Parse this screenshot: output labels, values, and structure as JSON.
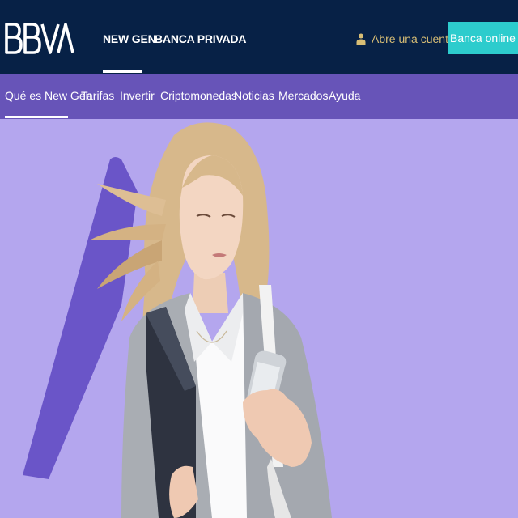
{
  "brand": {
    "logo_text": "BBVA"
  },
  "header": {
    "tabs": [
      {
        "label": "NEW GEN",
        "active": true
      },
      {
        "label": "BANCA PRIVADA",
        "active": false
      }
    ],
    "open_account": {
      "label": "Abre una cuenta",
      "icon": "person-icon"
    },
    "online_button": {
      "label": "Banca online"
    }
  },
  "subnav": {
    "items": [
      {
        "label": "Qué es New Gen",
        "active": true
      },
      {
        "label": "Tarifas"
      },
      {
        "label": "Invertir"
      },
      {
        "label": "Criptomonedas"
      },
      {
        "label": "Noticias"
      },
      {
        "label": "Mercados"
      },
      {
        "label": "Ayuda"
      }
    ]
  },
  "hero": {
    "image": "woman-with-phone-and-folder"
  },
  "colors": {
    "header_bg": "#072146",
    "subnav_bg": "#6754B8",
    "hero_bg": "#B4A6EE",
    "accent_aqua": "#2DCCCD",
    "gold": "#D8BE75",
    "hero_shape": "#6A55C8"
  }
}
